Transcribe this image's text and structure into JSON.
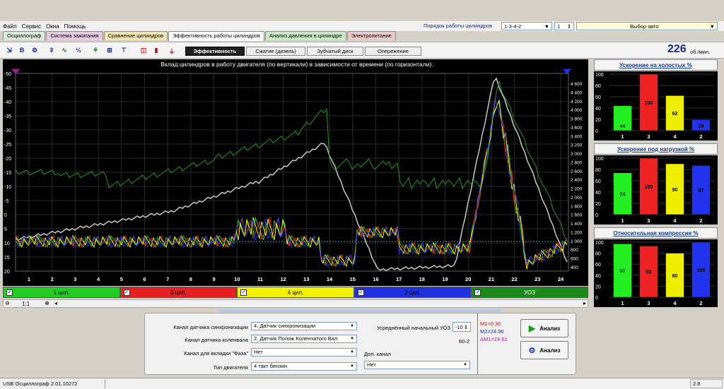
{
  "menu": [
    "Файл",
    "Сервис",
    "Окна",
    "Помощь"
  ],
  "firing_order": {
    "label": "Порядок работы цилиндров",
    "value": "1-3-4-2",
    "spin": "1"
  },
  "auto": {
    "value": "Выбор авто"
  },
  "tabs": [
    {
      "label": "Осциллограф",
      "color": "#d9e9d9"
    },
    {
      "label": "Система зажигания",
      "color": "#e6c8e0"
    },
    {
      "label": "Сравнение цилиндров",
      "color": "#eee4b0"
    },
    {
      "label": "Эффективность работы цилиндров",
      "color": "#ffffff"
    },
    {
      "label": "Анализ давления в цилиндре",
      "color": "#c8e8c8"
    },
    {
      "label": "Электропитание",
      "color": "#e8c8c8"
    }
  ],
  "subtabs": [
    "Эффективность",
    "Сжатие (дизель)",
    "Зубчатый диск",
    "Опережение"
  ],
  "rpm": {
    "value": "226",
    "unit": "об./мин."
  },
  "chart": {
    "title": "Вклад цилиндров в работу двигателя (по вертикали) в зависимости от времени (по горизонтали).",
    "left_ticks": [
      "-50",
      "-45",
      "-40",
      "-35",
      "-30",
      "-25",
      "-20",
      "-15",
      "-10",
      "-5",
      "0",
      "5",
      "10",
      "15",
      "20"
    ],
    "right_ticks": [
      "4 600",
      "4 400",
      "4 200",
      "4 000",
      "3 800",
      "3 600",
      "3 400",
      "3 200",
      "3 000",
      "2 800",
      "2 600",
      "2 400",
      "2 200",
      "2 000",
      "1 800",
      "1 600",
      "1 400",
      "1 200",
      "1 000",
      "800",
      "600",
      "400"
    ],
    "x_ticks": [
      "1",
      "2",
      "3",
      "4",
      "5",
      "6",
      "7",
      "8",
      "9",
      "10",
      "11",
      "12",
      "13",
      "14",
      "15",
      "16",
      "17",
      "18",
      "19",
      "20",
      "21",
      "22",
      "23",
      "24"
    ]
  },
  "cylinders": [
    {
      "label": "1 цил.",
      "color": "#22cc22"
    },
    {
      "label": "3 цил.",
      "color": "#e62020"
    },
    {
      "label": "4 цил.",
      "color": "#f2f200"
    },
    {
      "label": "2 цил.",
      "color": "#2030e0"
    },
    {
      "label": "УОЗ",
      "color": "#1a8a1a"
    }
  ],
  "zoom": "1:1",
  "panels": [
    {
      "title": "Ускорение на холостых %",
      "labels": [
        "1",
        "3",
        "4",
        "2"
      ],
      "values": [
        44,
        100,
        62,
        19
      ]
    },
    {
      "title": "Ускорение под нагрузкой %",
      "labels": [
        "1",
        "3",
        "4",
        "2"
      ],
      "values": [
        74,
        100,
        90,
        87
      ]
    },
    {
      "title": "Относительная компрессия %",
      "labels": [
        "1",
        "3",
        "4",
        "2"
      ],
      "values": [
        97,
        93,
        80,
        100
      ]
    }
  ],
  "bar_axis": [
    "100",
    "80",
    "60",
    "40",
    "20",
    "0"
  ],
  "bar_colors": [
    "#22ee22",
    "#ee2222",
    "#eeee00",
    "#2233ee"
  ],
  "form": {
    "sync_label": "Канал датчика синхронизации",
    "sync_value": "4. Датчик синхронизации",
    "crank_label": "Канал датчика коленвала",
    "crank_value": "2. Датчик Полож Коленчатого Вал",
    "phase_label": "Канал для вкладки \"Фаза\"",
    "phase_value": "Нет",
    "engine_label": "Тип двигателя",
    "engine_value": "4 такт бензин",
    "uoz_label": "Усреднённый начальный УОЗ",
    "uoz_value": "-10",
    "teeth": "60-2",
    "extra_label": "Доп. канал",
    "extra_value": "Нет",
    "m1": "M1=0.36",
    "m2": "M2=24.96",
    "dm": "ΔM1=24.61",
    "btn1": "Анализ",
    "btn2": "Анализ"
  },
  "status": {
    "left": "USB Осциллограф  2.01.10272",
    "right": "2.8"
  }
}
